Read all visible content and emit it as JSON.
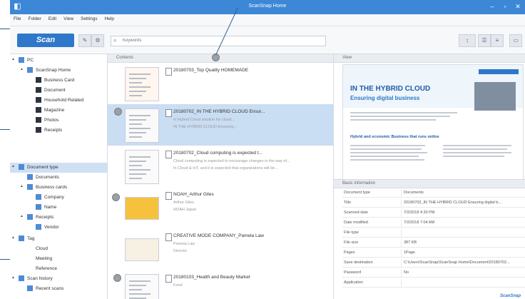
{
  "window": {
    "title": "ScanSnap Home",
    "minimize": "–",
    "maximize": "▫",
    "close": "✕"
  },
  "menu": [
    "File",
    "Folder",
    "Edit",
    "View",
    "Settings",
    "Help"
  ],
  "toolbar": {
    "scan_label": "Scan",
    "search_placeholder": "Keywords"
  },
  "tree": [
    {
      "label": "PC",
      "level": 0,
      "icon": "pc-icon",
      "twisty": "▲"
    },
    {
      "label": "ScanSnap Home",
      "level": 1,
      "icon": "home-icon",
      "twisty": "▲"
    },
    {
      "label": "Business Card",
      "level": 2,
      "icon": "folder-icon"
    },
    {
      "label": "Document",
      "level": 2,
      "icon": "folder-icon"
    },
    {
      "label": "Household Related",
      "level": 2,
      "icon": "folder-icon"
    },
    {
      "label": "Magazine",
      "level": 2,
      "icon": "folder-icon"
    },
    {
      "label": "Photos",
      "level": 2,
      "icon": "folder-icon"
    },
    {
      "label": "Receipts",
      "level": 2,
      "icon": "folder-icon"
    },
    {
      "label": "Document type",
      "level": 0,
      "icon": "document-type-icon",
      "twisty": "▲",
      "selected": true
    },
    {
      "label": "Documents",
      "level": 1,
      "icon": "documents-icon"
    },
    {
      "label": "Business cards",
      "level": 1,
      "icon": "business-cards-icon",
      "twisty": "▲"
    },
    {
      "label": "Company",
      "level": 2,
      "icon": "company-icon"
    },
    {
      "label": "Name",
      "level": 2,
      "icon": "person-icon"
    },
    {
      "label": "Receipts",
      "level": 1,
      "icon": "receipts-icon",
      "twisty": "▲"
    },
    {
      "label": "Vendor",
      "level": 2,
      "icon": "vendor-icon"
    },
    {
      "label": "Tag",
      "level": 0,
      "icon": "tag-icon",
      "twisty": "▲"
    },
    {
      "label": "Cloud",
      "level": 1,
      "icon": ""
    },
    {
      "label": "Meeting",
      "level": 1,
      "icon": ""
    },
    {
      "label": "Reference",
      "level": 1,
      "icon": ""
    },
    {
      "label": "Scan history",
      "level": 0,
      "icon": "scan-history-icon",
      "twisty": "▲"
    },
    {
      "label": "Recent scans",
      "level": 1,
      "icon": "recent-scans-icon"
    }
  ],
  "list": {
    "header": "Contents",
    "items": [
      {
        "title": "20180703_Top Quality HOMEMADE",
        "sub1": "",
        "sub2": "",
        "thumb": "menu"
      },
      {
        "title": "20180702_IN THE HYBRID CLOUD Ensur...",
        "sub1": "In Hybrid Cloud solution for cloud...",
        "sub2": "IN THE HYBRID CLOUD Ensuring...",
        "thumb": "doc",
        "selected": true
      },
      {
        "title": "20180702_Cloud computing is expected t...",
        "sub1": "Cloud computing is expected to encourage changes in the way of...",
        "sub2": "In Cloud & IoT, and it is expected that organizations will be...",
        "thumb": "doc"
      },
      {
        "title": "NOAH_Arthur Giles",
        "sub1": "Arthur Giles",
        "sub2": "NOAH Japan",
        "thumb": "card"
      },
      {
        "title": "CREATIVE MODE COMPANY_Pamela Law",
        "sub1": "Pamela Law",
        "sub2": "Director",
        "thumb": "card2"
      },
      {
        "title": "20180103_Health and Beauty Market",
        "sub1": "Food",
        "sub2": "",
        "thumb": "receipt"
      }
    ]
  },
  "view": {
    "header": "View",
    "doc_heading_1": "IN THE HYBRID CLOUD",
    "doc_heading_2": "Ensuring digital business",
    "doc_heading_3": "Hybrid and economic Business that runs online"
  },
  "info": {
    "header": "Basic information",
    "rows": [
      {
        "k": "Document type",
        "v": "Documents"
      },
      {
        "k": "Title",
        "v": "20180702_IN THE HYBRID CLOUD Ensuring digital b..."
      },
      {
        "k": "Scanned date",
        "v": "7/2/2018 4:30 PM"
      },
      {
        "k": "Date modified",
        "v": "7/2/2018 7:04 AM"
      },
      {
        "k": "File type",
        "v": ""
      },
      {
        "k": "File size",
        "v": "387 KB"
      },
      {
        "k": "Pages",
        "v": "1Page"
      },
      {
        "k": "Save destination",
        "v": "C:\\Users\\ScanSnap\\ScanSnap Home\\Document\\20180702..."
      },
      {
        "k": "Password",
        "v": "No"
      },
      {
        "k": "Application",
        "v": ""
      }
    ]
  },
  "brand": "ScanSnap"
}
